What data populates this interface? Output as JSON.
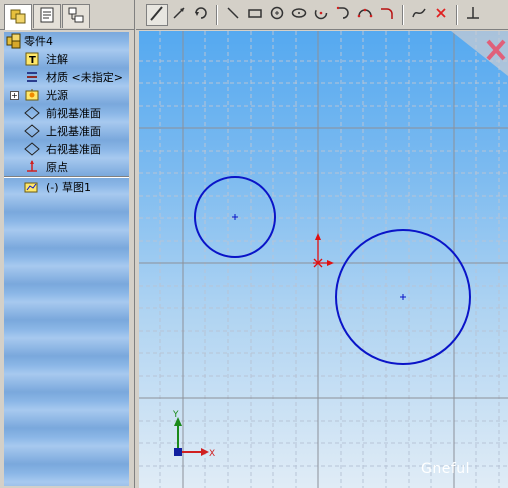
{
  "tabs": [
    {
      "icon": "feature-manager-icon",
      "active": true
    },
    {
      "icon": "property-manager-icon",
      "active": false
    },
    {
      "icon": "configuration-manager-icon",
      "active": false
    }
  ],
  "tree": {
    "part": "零件4",
    "annotations": "注解",
    "material": "材质 <未指定>",
    "lights": "光源",
    "front_plane": "前视基准面",
    "top_plane": "上视基准面",
    "right_plane": "右视基准面",
    "origin": "原点",
    "sketch": "(-) 草图1"
  },
  "toolbar": {
    "tools": [
      "sketch-icon",
      "smart-dimension-icon",
      "rebuild-icon",
      "line-icon",
      "rectangle-icon",
      "circle-icon",
      "ellipse-icon",
      "centerpoint-arc-icon",
      "tangent-arc-icon",
      "3point-arc-icon",
      "fillet-icon",
      "spline-icon",
      "exit-icon",
      "relation-icon"
    ]
  },
  "axes": {
    "y_label": "Y",
    "x_label": "X"
  },
  "watermark": "Gneful",
  "colors": {
    "sketch": "#0a14c8",
    "origin": "#e01010",
    "grid_major": "#8c9099",
    "grid_minor": "#b7c4d6"
  }
}
